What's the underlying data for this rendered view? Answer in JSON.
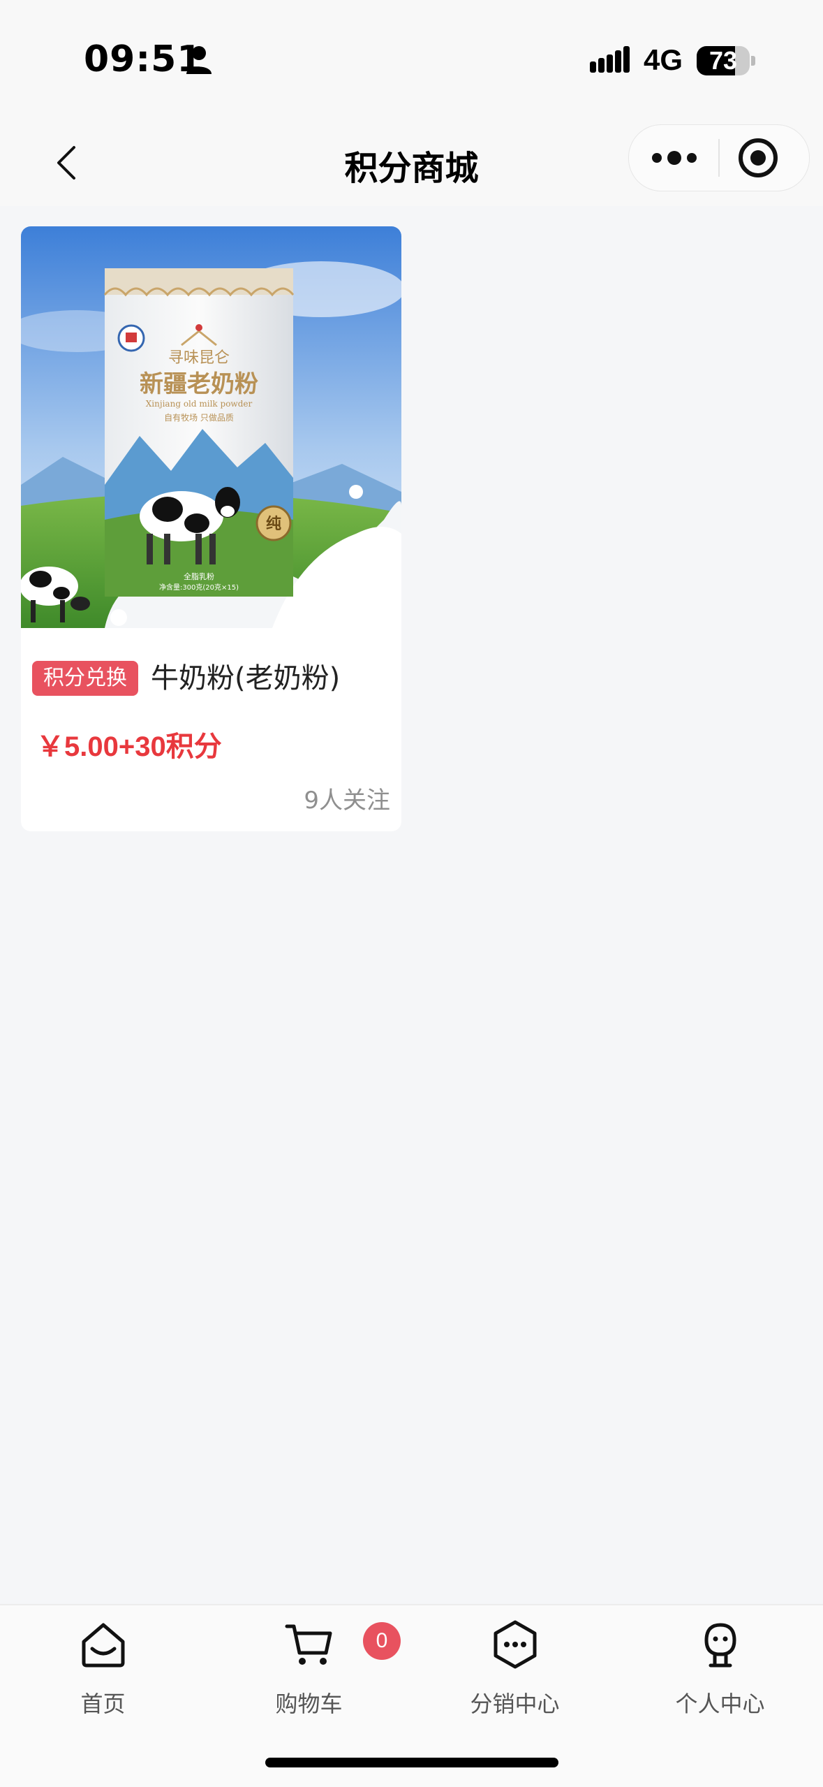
{
  "status_bar": {
    "time": "09:51",
    "network": "4G",
    "battery": "73",
    "battery_level": 0.73
  },
  "nav": {
    "title": "积分商城"
  },
  "product": {
    "badge": "积分兑换",
    "name": "牛奶粉(老奶粉)",
    "price": "￥5.00+30积分",
    "followers": "9人关注",
    "image_text": {
      "brand": "寻味昆仑",
      "title": "新疆老奶粉",
      "subtitle": "Xinjiang old milk powder",
      "slogan": "自有牧场 只做品质",
      "seal": "纯",
      "type": "全脂乳粉",
      "net": "净含量:300克(20克×15)"
    }
  },
  "tab_bar": {
    "items": [
      {
        "label": "首页",
        "icon": "home-icon"
      },
      {
        "label": "购物车",
        "icon": "cart-icon"
      },
      {
        "label": "分销中心",
        "icon": "distribution-icon"
      },
      {
        "label": "个人中心",
        "icon": "profile-icon"
      }
    ],
    "cart_count": "0"
  },
  "colors": {
    "accent": "#e8525f",
    "price": "#e8383d",
    "background": "#f5f6f8"
  }
}
